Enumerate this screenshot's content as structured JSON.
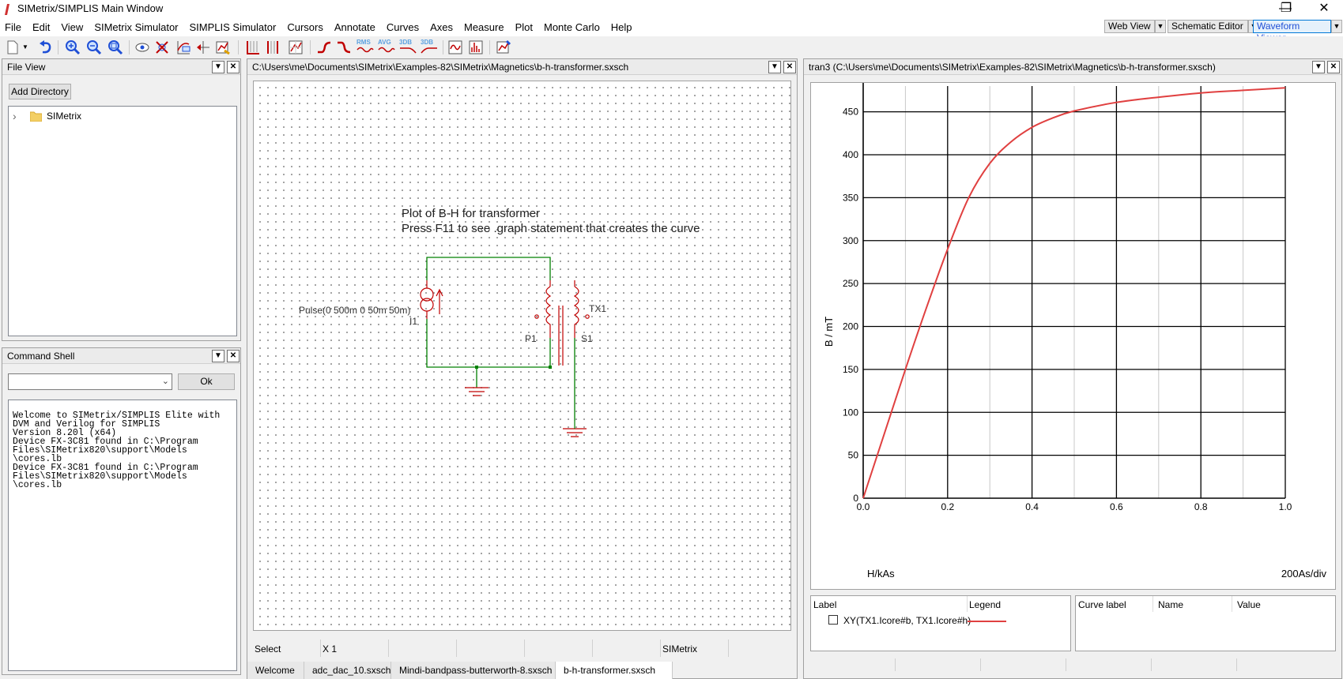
{
  "window": {
    "title": "SIMetrix/SIMPLIS Main Window",
    "min_glyph": "—",
    "max_glyph": "❐",
    "close_glyph": "✕"
  },
  "menu": [
    "File",
    "Edit",
    "View",
    "SIMetrix Simulator",
    "SIMPLIS Simulator",
    "Cursors",
    "Annotate",
    "Curves",
    "Axes",
    "Measure",
    "Plot",
    "Monte Carlo",
    "Help"
  ],
  "view_switch": {
    "web_view": "Web View",
    "schematic_editor": "Schematic Editor",
    "waveform_viewer": "Waveform Viewer",
    "drop_glyph": "▼"
  },
  "toolbar_text": {
    "rms": "RMS",
    "avg": "AVG",
    "db3": "3DB",
    "db3b": "3DB"
  },
  "colors": {
    "accent_blue": "#1f4fd6",
    "wire_green": "#008000",
    "component_red": "#c00000",
    "curve_red": "#e04040"
  },
  "file_view": {
    "title": "File View",
    "add_directory": "Add Directory",
    "tree": [
      {
        "label": "SIMetrix",
        "expander": "›",
        "icon": "folder-icon"
      }
    ]
  },
  "command_shell": {
    "title": "Command Shell",
    "ok": "Ok",
    "input_value": "",
    "output_lines": [
      "Welcome to SIMetrix/SIMPLIS Elite with",
      "DVM and Verilog for SIMPLIS",
      "Version 8.20l (x64)",
      "Device FX-3C81 found in C:\\Program",
      "Files\\SIMetrix820\\support\\Models",
      "\\cores.lb",
      "Device FX-3C81 found in C:\\Program",
      "Files\\SIMetrix820\\support\\Models",
      "\\cores.lb"
    ]
  },
  "schematic": {
    "title": "C:\\Users\\me\\Documents\\SIMetrix\\Examples-82\\SIMetrix\\Magnetics\\b-h-transformer.sxsch",
    "annotation_line1": "Plot of B-H for transformer",
    "annotation_line2": "Press F11 to see .graph statement that creates the curve",
    "source_value": "Pulse(0 500m 0 50m 50m)",
    "source_ref": "I1",
    "transformer_ref": "TX1",
    "primary_ref": "P1",
    "secondary_ref": "S1",
    "status": {
      "mode": "Select",
      "zoom": "X 1",
      "simulator": "SIMetrix"
    },
    "tabs": [
      {
        "label": "Welcome",
        "active": false
      },
      {
        "label": "adc_dac_10.sxsch",
        "active": false
      },
      {
        "label": "Mindi-bandpass-butterworth-8.sxsch",
        "active": false
      },
      {
        "label": "b-h-transformer.sxsch",
        "active": true
      }
    ]
  },
  "waveform": {
    "title": "tran3 (C:\\Users\\me\\Documents\\SIMetrix\\Examples-82\\SIMetrix\\Magnetics\\b-h-transformer.sxsch)",
    "x_axis_label": "H/kAs",
    "x_axis_div": "200As/div",
    "legend_headers": {
      "label": "Label",
      "legend": "Legend"
    },
    "legend_entries": [
      {
        "label": "XY(TX1.Icore#b, TX1.Icore#h)",
        "checked": false
      }
    ],
    "cursor_headers": {
      "curve_label": "Curve label",
      "name": "Name",
      "value": "Value"
    }
  },
  "chart_data": {
    "type": "line",
    "title": "",
    "xlabel": "H/kAs",
    "ylabel": "B / mT",
    "xlim": [
      0,
      1.0
    ],
    "ylim": [
      0,
      480
    ],
    "x_ticks": [
      "0.0",
      "0.2",
      "0.4",
      "0.6",
      "0.8",
      "1.0"
    ],
    "y_ticks": [
      "0",
      "50",
      "100",
      "150",
      "200",
      "250",
      "300",
      "350",
      "400",
      "450"
    ],
    "grid": true,
    "legend": "bottom-panel",
    "series": [
      {
        "name": "XY(TX1.Icore#b, TX1.Icore#h)",
        "color": "#e04040",
        "x": [
          0,
          0.05,
          0.1,
          0.15,
          0.2,
          0.25,
          0.3,
          0.35,
          0.4,
          0.45,
          0.5,
          0.6,
          0.7,
          0.8,
          0.9,
          1.0
        ],
        "y": [
          0,
          75,
          150,
          222,
          290,
          350,
          390,
          415,
          432,
          443,
          451,
          461,
          467,
          472,
          475,
          478
        ]
      }
    ]
  }
}
